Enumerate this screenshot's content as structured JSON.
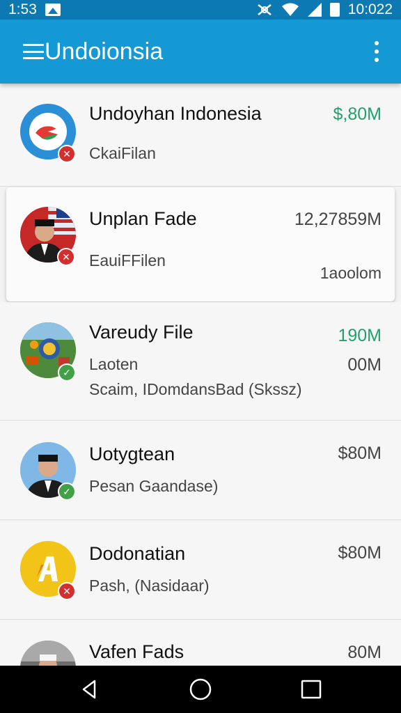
{
  "status_bar": {
    "time": "1:53",
    "clock": "10:022"
  },
  "app_bar": {
    "title": "Undoionsia"
  },
  "items": [
    {
      "title": "Undoyhan Indonesia",
      "subtitle": "CkaiFilan",
      "value": "$,80M",
      "value_color": "#23a06b"
    },
    {
      "title": "Unplan Fade",
      "subtitle": "EauiFFilen",
      "value": "12,27859M",
      "value2": "1aoolom"
    },
    {
      "title": "Vareudy File",
      "subtitle": "Laoten",
      "subtitle2": "Scaim, IDomdansBad (Skssz)",
      "value": "190M",
      "value_color": "#23a06b",
      "value2": "00M"
    },
    {
      "title": "Uotygtean",
      "subtitle": "Pesan Gaandase)",
      "value": "$80M"
    },
    {
      "title": "Dodonatian",
      "subtitle": "Pash, (Nasidaar)",
      "value": "$80M"
    },
    {
      "title": "Vafen Fads",
      "value": "80M"
    }
  ]
}
